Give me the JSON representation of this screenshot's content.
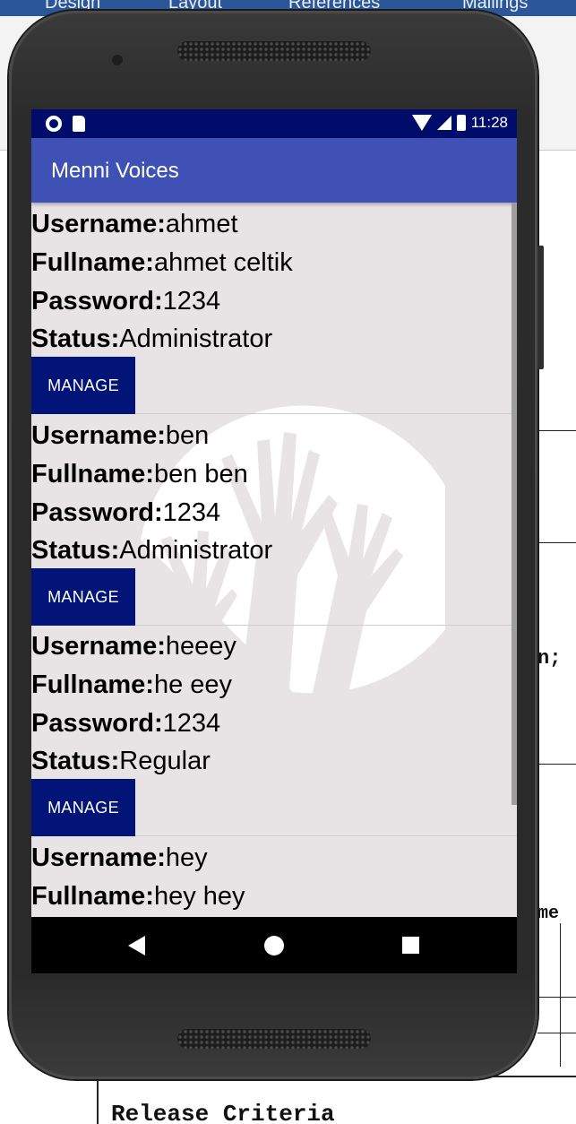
{
  "doc": {
    "ribbon_tabs": [
      "Design",
      "Layout",
      "References",
      "Mailings"
    ],
    "side_text_1": "n;",
    "side_text_2": "me",
    "release_criteria": "Release Criteria"
  },
  "statusbar": {
    "time": "11:28"
  },
  "app": {
    "title": "Menni Voices"
  },
  "labels": {
    "username": "Username:",
    "fullname": "Fullname:",
    "password": "Password:",
    "status": "Status:",
    "manage": "MANAGE"
  },
  "users": [
    {
      "username": "ahmet",
      "fullname": "ahmet celtik",
      "password": "1234",
      "status": "Administrator"
    },
    {
      "username": "ben",
      "fullname": "ben ben",
      "password": "1234",
      "status": "Administrator"
    },
    {
      "username": "heeey",
      "fullname": "he eey",
      "password": "1234",
      "status": "Regular"
    },
    {
      "username": "hey",
      "fullname": "hey hey",
      "password": "",
      "status": ""
    }
  ],
  "colors": {
    "statusbar": "#000c6a",
    "appbar": "#3f51b5",
    "button": "#021478",
    "screen_bg": "#e8e3e4"
  }
}
